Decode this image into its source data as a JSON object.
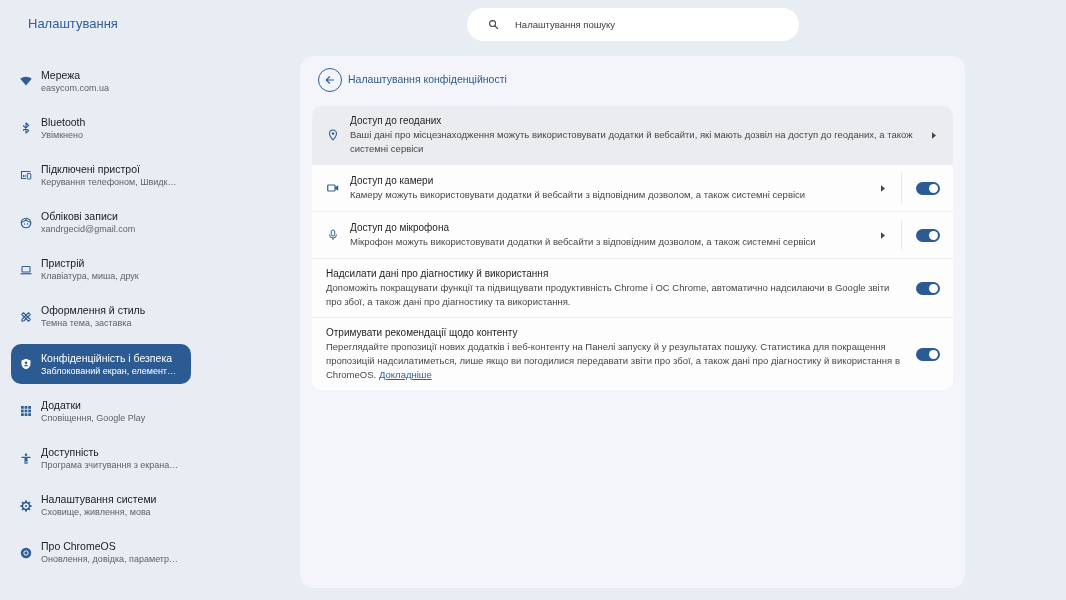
{
  "app": {
    "title": "Налаштування"
  },
  "search": {
    "placeholder": "Налаштування пошуку"
  },
  "sidebar": {
    "items": [
      {
        "title": "Мережа",
        "subtitle": "easycom.com.ua",
        "selected": false
      },
      {
        "title": "Bluetooth",
        "subtitle": "Увімкнено",
        "selected": false
      },
      {
        "title": "Підключені пристрої",
        "subtitle": "Керування телефоном, Швидк…",
        "selected": false
      },
      {
        "title": "Облікові записи",
        "subtitle": "xandrgecid@gmail.com",
        "selected": false
      },
      {
        "title": "Пристрій",
        "subtitle": "Клавіатура, миша, друк",
        "selected": false
      },
      {
        "title": "Оформлення й стиль",
        "subtitle": "Темна тема, заставка",
        "selected": false
      },
      {
        "title": "Конфіденційність і безпека",
        "subtitle": "Заблокований екран, елемент…",
        "selected": true
      },
      {
        "title": "Додатки",
        "subtitle": "Сповіщення, Google Play",
        "selected": false
      },
      {
        "title": "Доступність",
        "subtitle": "Програма зчитування з екрана…",
        "selected": false
      },
      {
        "title": "Налаштування системи",
        "subtitle": "Сховище, живлення, мова",
        "selected": false
      },
      {
        "title": "Про ChromeOS",
        "subtitle": "Оновлення, довідка, параметр…",
        "selected": false
      }
    ]
  },
  "page": {
    "title": "Налаштування конфіденційності",
    "settings": [
      {
        "kind": "link",
        "title": "Доступ до геоданих",
        "description": "Ваші дані про місцезнаходження можуть використовувати додатки й вебсайти, які мають дозвіл на доступ до геоданих, а також системні сервіси",
        "hovered": true
      },
      {
        "kind": "link_toggle",
        "title": "Доступ до камери",
        "description": "Камеру можуть використовувати додатки й вебсайти з відповідним дозволом, а також системні сервіси",
        "on": true,
        "hovered": false
      },
      {
        "kind": "link_toggle",
        "title": "Доступ до мікрофона",
        "description": "Мікрофон можуть використовувати додатки й вебсайти з відповідним дозволом, а також системні сервіси",
        "on": true,
        "hovered": false
      },
      {
        "kind": "toggle",
        "title": "Надсилати дані про діагностику й використання",
        "description": "Допоможіть покращувати функції та підвищувати продуктивність Chrome і ОС Chrome, автоматично надсилаючи в Google звіти про збої, а також дані про діагностику та використання.",
        "on": true,
        "hovered": false
      },
      {
        "kind": "toggle",
        "title": "Отримувати рекомендації щодо контенту",
        "description": "Переглядайте пропозиції нових додатків і веб-контенту на Панелі запуску й у результатах пошуку. Статистика для покращення пропозицій надсилатиметься, лише якщо ви погодилися передавати звіти про збої, а також дані про діагностику й використання в ChromeOS.",
        "link": "Докладніше",
        "on": true,
        "hovered": false
      }
    ]
  }
}
